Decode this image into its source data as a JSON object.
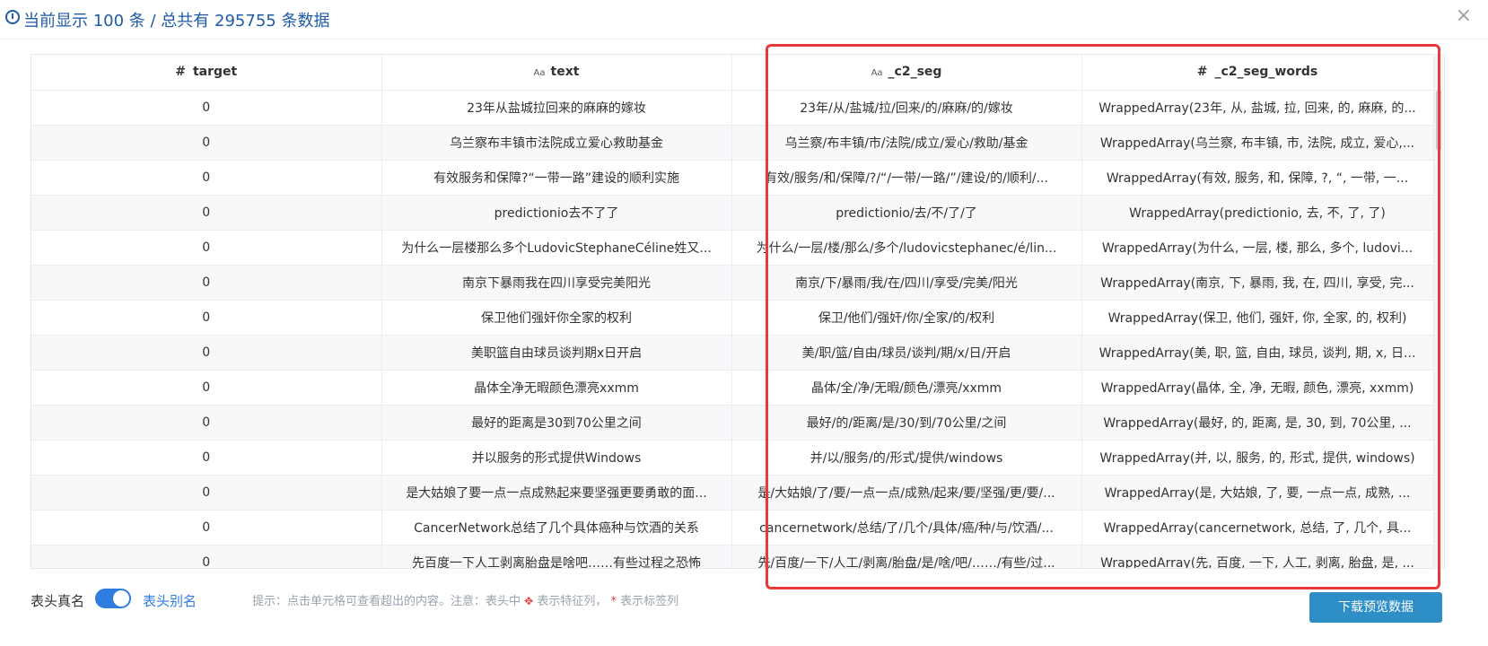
{
  "header": {
    "title": "当前显示 100 条 / 总共有 295755 条数据",
    "close": "×"
  },
  "table": {
    "columns": [
      {
        "icon": "#",
        "name": "target"
      },
      {
        "icon": "Aa",
        "name": "text"
      },
      {
        "icon": "Aa",
        "name": "_c2_seg"
      },
      {
        "icon": "#",
        "name": "_c2_seg_words"
      }
    ],
    "rows": [
      [
        "0",
        "23年从盐城拉回来的麻麻的嫁妆",
        "23年/从/盐城/拉/回来/的/麻麻/的/嫁妆",
        "WrappedArray(23年, 从, 盐城, 拉, 回来, 的, 麻麻, 的..."
      ],
      [
        "0",
        "乌兰察布丰镇市法院成立爱心救助基金",
        "乌兰察/布丰镇/市/法院/成立/爱心/救助/基金",
        "WrappedArray(乌兰察, 布丰镇, 市, 法院, 成立, 爱心,..."
      ],
      [
        "0",
        "有效服务和保障?“一带一路”建设的顺利实施",
        "有效/服务/和/保障/?/“/一带/一路/”/建设/的/顺利/...",
        "WrappedArray(有效, 服务, 和, 保障, ?, “, 一带, 一..."
      ],
      [
        "0",
        "predictionio去不了了",
        "predictionio/去/不/了/了",
        "WrappedArray(predictionio, 去, 不, 了, 了)"
      ],
      [
        "0",
        "为什么一层楼那么多个LudovicStephaneCéline姓又...",
        "为什么/一层/楼/那么/多个/ludovicstephanec/é/lin...",
        "WrappedArray(为什么, 一层, 楼, 那么, 多个, ludovi..."
      ],
      [
        "0",
        "南京下暴雨我在四川享受完美阳光",
        "南京/下/暴雨/我/在/四川/享受/完美/阳光",
        "WrappedArray(南京, 下, 暴雨, 我, 在, 四川, 享受, 完..."
      ],
      [
        "0",
        "保卫他们强奸你全家的权利",
        "保卫/他们/强奸/你/全家/的/权利",
        "WrappedArray(保卫, 他们, 强奸, 你, 全家, 的, 权利)"
      ],
      [
        "0",
        "美职篮自由球员谈判期x日开启",
        "美/职/篮/自由/球员/谈判/期/x/日/开启",
        "WrappedArray(美, 职, 篮, 自由, 球员, 谈判, 期, x, 日..."
      ],
      [
        "0",
        "晶体全净无暇颜色漂亮xxmm",
        "晶体/全/净/无暇/颜色/漂亮/xxmm",
        "WrappedArray(晶体, 全, 净, 无暇, 颜色, 漂亮, xxmm)"
      ],
      [
        "0",
        "最好的距离是30到70公里之间",
        "最好/的/距离/是/30/到/70公里/之间",
        "WrappedArray(最好, 的, 距离, 是, 30, 到, 70公里, ..."
      ],
      [
        "0",
        "并以服务的形式提供Windows",
        "并/以/服务/的/形式/提供/windows",
        "WrappedArray(并, 以, 服务, 的, 形式, 提供, windows)"
      ],
      [
        "0",
        "是大姑娘了要一点一点成熟起来要坚强更要勇敢的面...",
        "是/大姑娘/了/要/一点一点/成熟/起来/要/坚强/更/要/...",
        "WrappedArray(是, 大姑娘, 了, 要, 一点一点, 成熟, ..."
      ],
      [
        "0",
        "CancerNetwork总结了几个具体癌种与饮酒的关系",
        "cancernetwork/总结/了/几个/具体/癌/种/与/饮酒/...",
        "WrappedArray(cancernetwork, 总结, 了, 几个, 具..."
      ],
      [
        "0",
        "先百度一下人工剥离胎盘是啥吧……有些过程之恐怖",
        "先/百度/一下/人工/剥离/胎盘/是/啥/吧/……/有些/过...",
        "WrappedArray(先, 百度, 一下, 人工, 剥离, 胎盘, 是, ..."
      ]
    ]
  },
  "footer": {
    "label_real": "表头真名",
    "toggle_on": true,
    "label_alias": "表头别名",
    "hint_prefix": "提示：点击单元格可查看超出的内容。注意：表头中",
    "hint_feature": "表示特征列，",
    "hint_star": "*",
    "hint_label": "表示标签列",
    "download": "下载预览数据"
  },
  "colors": {
    "accent": "#2f7de1",
    "title": "#1f5aa6",
    "highlight": "#e83a3a",
    "button": "#2d8fc5"
  },
  "icons": {
    "header_icon": "clock-icon",
    "close": "close-icon",
    "feature": "feature-column-icon"
  }
}
